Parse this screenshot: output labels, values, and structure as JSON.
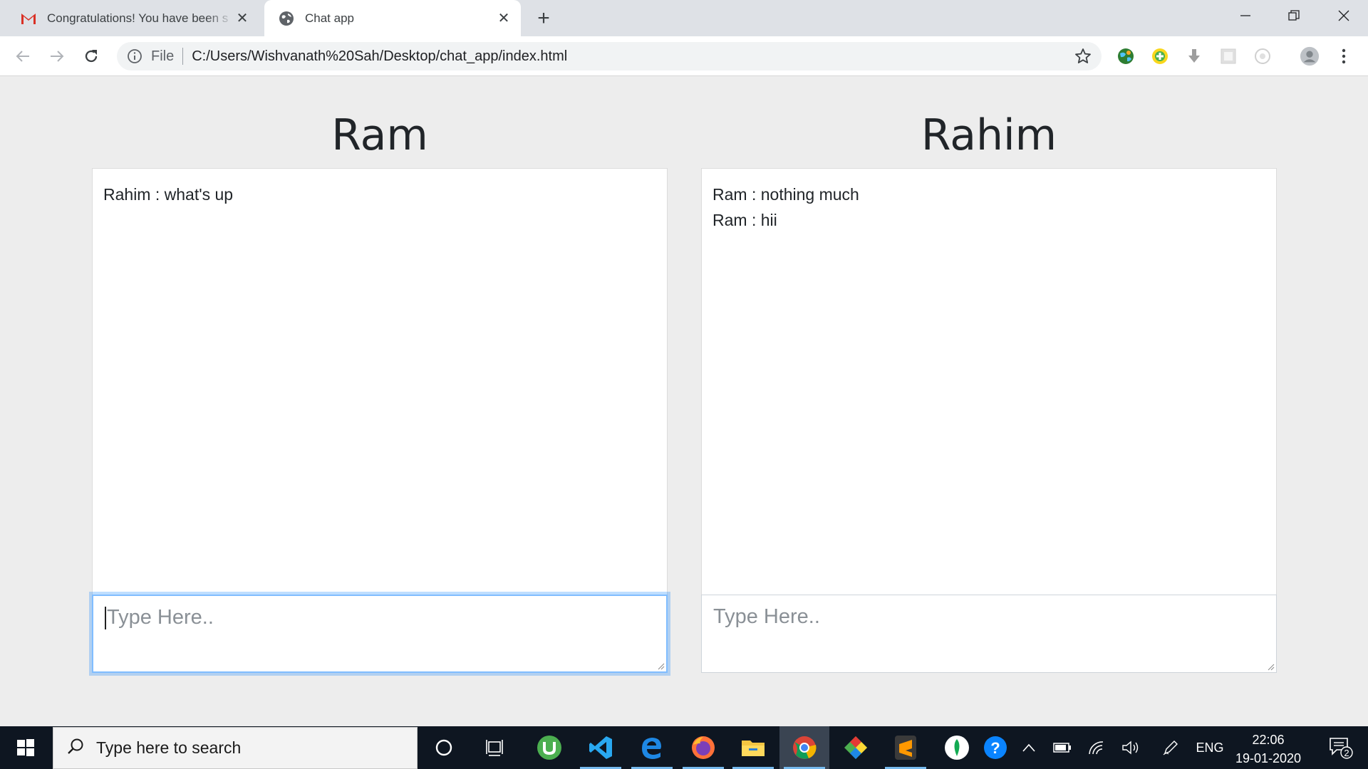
{
  "browser": {
    "tabs": [
      {
        "title": "Congratulations! You have been s",
        "icon": "gmail-icon"
      },
      {
        "title": "Chat app",
        "icon": "globe-icon"
      }
    ],
    "address": {
      "scheme_label": "File",
      "url": "C:/Users/Wishvanath%20Sah/Desktop/chat_app/index.html"
    }
  },
  "chats": [
    {
      "name": "Ram",
      "messages": [
        "Rahim : what's up"
      ],
      "input_placeholder": "Type Here..",
      "focused": true
    },
    {
      "name": "Rahim",
      "messages": [
        "Ram : nothing much",
        "Ram : hii"
      ],
      "input_placeholder": "Type Here..",
      "focused": false
    }
  ],
  "taskbar": {
    "search_placeholder": "Type here to search",
    "language": "ENG",
    "time": "22:06",
    "date": "19-01-2020",
    "notification_count": "2"
  },
  "colors": {
    "focus_border": "#80bdff",
    "taskbar_bg": "#0e1621",
    "page_bg": "#ededed"
  }
}
